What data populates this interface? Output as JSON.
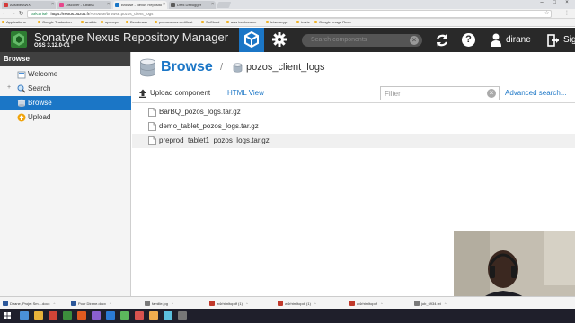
{
  "browser": {
    "tabs": [
      {
        "title": "Ansible AWX",
        "color": "#d43a3a"
      },
      {
        "title": "Discover - Kibana",
        "color": "#e7478b"
      },
      {
        "title": "Browse - Nexus Reposito",
        "color": "#1b76c6"
      },
      {
        "title": "Drek Debugger",
        "color": "#5b5b5b"
      }
    ],
    "active_tab": 2,
    "address": {
      "secure_label": "Sécurisé",
      "host": "https://nexus.pozos.fr",
      "path": "/#browse/browse:pozos_client_logs"
    },
    "bookmarks": [
      "Applications",
      "Google Traduction",
      "ansible",
      "openvpn",
      "Decidesan",
      "pozosnexus certificat",
      "SoCloud",
      "aws tourbanene",
      "letsencrypt",
      "travis",
      "Google Image Reco"
    ]
  },
  "nexus": {
    "product_title": "Sonatype Nexus Repository Manager",
    "version": "OSS 3.12.0-01",
    "search_placeholder": "Search components",
    "username": "dirane",
    "signin_label": "Sig"
  },
  "sidebar": {
    "header": "Browse",
    "items": [
      {
        "label": "Welcome",
        "icon": "welcome-icon",
        "selected": false,
        "expandable": false
      },
      {
        "label": "Search",
        "icon": "search-icon",
        "selected": false,
        "expandable": true
      },
      {
        "label": "Browse",
        "icon": "browse-icon",
        "selected": true,
        "expandable": false
      },
      {
        "label": "Upload",
        "icon": "upload-icon",
        "selected": false,
        "expandable": false
      }
    ]
  },
  "main": {
    "breadcrumb_title": "Browse",
    "breadcrumb_sep": "/",
    "repository": "pozos_client_logs",
    "upload_label": "Upload component",
    "html_view_label": "HTML View",
    "filter_placeholder": "Filter",
    "advanced_search_label": "Advanced search...",
    "files": [
      "BarBQ_pozos_logs.tar.gz",
      "demo_tablet_pozos_logs.tar.gz",
      "preprod_tablet1_pozos_logs.tar.gz"
    ],
    "hover_row": 2
  },
  "downloads": [
    {
      "name": "Dirane, Projet Sm....docx",
      "color": "#2b579a"
    },
    {
      "name": "Pour Dirane.docx",
      "color": "#2b579a"
    },
    {
      "name": "famille.jpg",
      "color": "#7a7a7a"
    },
    {
      "name": "w4rhtmltopdf (1)",
      "color": "#c0392b"
    },
    {
      "name": "w4rhtmltopdf (1)",
      "color": "#c0392b"
    },
    {
      "name": "w4rhtmltopdf",
      "color": "#c0392b"
    },
    {
      "name": "job_6934.txt",
      "color": "#7a7a7a"
    }
  ],
  "taskbar_apps": [
    "#4a90d9",
    "#e8b23a",
    "#d04437",
    "#3c8d3c",
    "#e05a20",
    "#8a5fd0",
    "#2b7bd6",
    "#5cb85c",
    "#d9534f",
    "#f0ad4e",
    "#5bc0de",
    "#777777"
  ]
}
